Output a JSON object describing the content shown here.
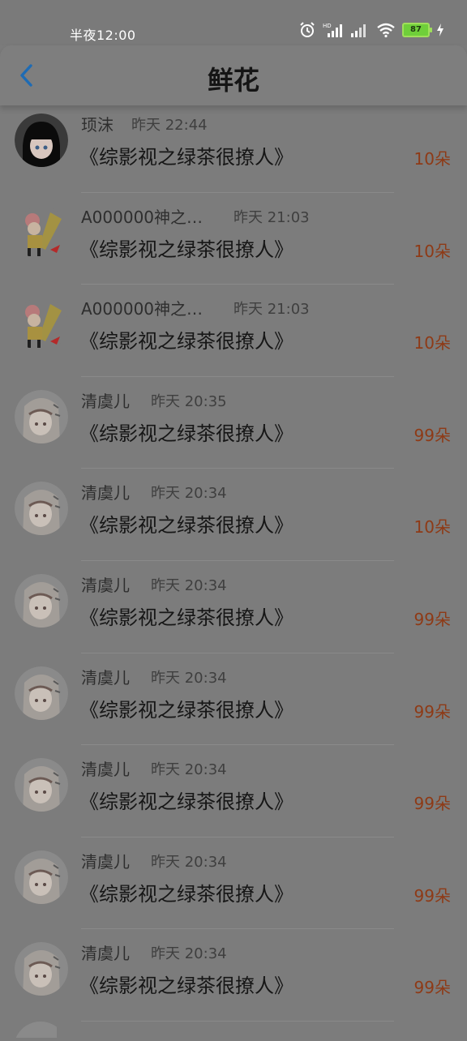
{
  "status_bar": {
    "time": "半夜12:00",
    "battery": "87",
    "icons": [
      "alarm-icon",
      "hd-signal-icon",
      "signal-icon",
      "wifi-icon",
      "battery-icon",
      "charging-icon"
    ]
  },
  "header": {
    "title": "鲜花",
    "back_icon": "chevron-left-icon"
  },
  "colors": {
    "background": "#7c7c7c",
    "accent": "#1e6bb4",
    "count": "#8e3a16"
  },
  "rows": [
    {
      "name": "顼沫",
      "time": "昨天 22:44",
      "book": "《综影视之绿茶很撩人》",
      "count": "10朵",
      "avatar": "anime-girl-dark"
    },
    {
      "name": "A000000神之…",
      "time": "昨天 21:03",
      "book": "《综影视之绿茶很撩人》",
      "count": "10朵",
      "avatar": "chibi-character"
    },
    {
      "name": "A000000神之…",
      "time": "昨天 21:03",
      "book": "《综影视之绿茶很撩人》",
      "count": "10朵",
      "avatar": "chibi-character"
    },
    {
      "name": "清虞儿",
      "time": "昨天 20:35",
      "book": "《综影视之绿茶很撩人》",
      "count": "99朵",
      "avatar": "anime-girl-light"
    },
    {
      "name": "清虞儿",
      "time": "昨天 20:34",
      "book": "《综影视之绿茶很撩人》",
      "count": "10朵",
      "avatar": "anime-girl-light"
    },
    {
      "name": "清虞儿",
      "time": "昨天 20:34",
      "book": "《综影视之绿茶很撩人》",
      "count": "99朵",
      "avatar": "anime-girl-light"
    },
    {
      "name": "清虞儿",
      "time": "昨天 20:34",
      "book": "《综影视之绿茶很撩人》",
      "count": "99朵",
      "avatar": "anime-girl-light"
    },
    {
      "name": "清虞儿",
      "time": "昨天 20:34",
      "book": "《综影视之绿茶很撩人》",
      "count": "99朵",
      "avatar": "anime-girl-light"
    },
    {
      "name": "清虞儿",
      "time": "昨天 20:34",
      "book": "《综影视之绿茶很撩人》",
      "count": "99朵",
      "avatar": "anime-girl-light"
    },
    {
      "name": "清虞儿",
      "time": "昨天 20:34",
      "book": "《综影视之绿茶很撩人》",
      "count": "99朵",
      "avatar": "anime-girl-light"
    }
  ]
}
